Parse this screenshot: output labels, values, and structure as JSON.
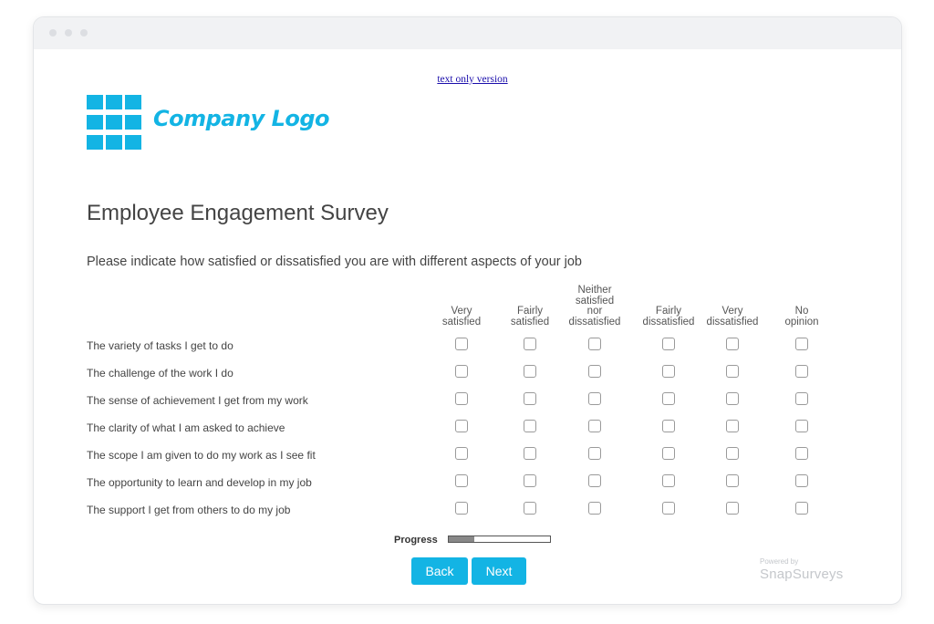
{
  "text_only_link": "text only version",
  "logo_text": "Company Logo",
  "survey_title": "Employee Engagement Survey",
  "instructions": "Please indicate how satisfied or dissatisfied you are with different aspects of your job",
  "columns": [
    {
      "lines": [
        "Very",
        "satisfied"
      ]
    },
    {
      "lines": [
        "Fairly",
        "satisfied"
      ]
    },
    {
      "lines": [
        "Neither",
        "satisfied",
        "nor",
        "dissatisfied"
      ]
    },
    {
      "lines": [
        "Fairly",
        "dissatisfied"
      ]
    },
    {
      "lines": [
        "Very",
        "dissatisfied"
      ]
    },
    {
      "lines": [
        "No",
        "opinion"
      ]
    }
  ],
  "rows": [
    {
      "label": "The variety of tasks I get to do"
    },
    {
      "label": "The challenge of the work I do"
    },
    {
      "label": "The sense of achievement I get from my work"
    },
    {
      "label": "The clarity of what I am asked to achieve"
    },
    {
      "label": "The scope I am given to do my work as I see fit"
    },
    {
      "label": "The opportunity to learn and develop in my job"
    },
    {
      "label": "The support I get from others to do my job"
    }
  ],
  "progress": {
    "label": "Progress",
    "fraction": 0.25
  },
  "buttons": {
    "back": "Back",
    "next": "Next"
  },
  "branding": {
    "powered_by": "Powered by",
    "name": "SnapSurveys"
  },
  "colors": {
    "accent": "#13b4e4"
  }
}
